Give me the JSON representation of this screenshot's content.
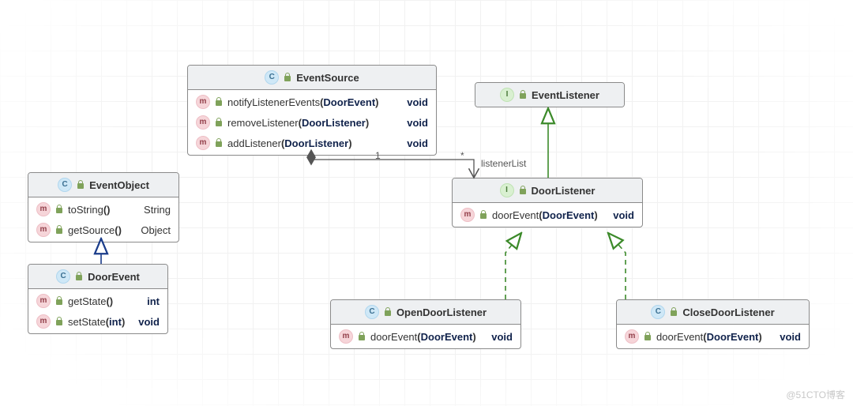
{
  "watermark": "@51CTO博客",
  "classes": {
    "EventSource": {
      "name": "EventSource",
      "stereotype": "C",
      "methods": [
        {
          "name": "notifyListenerEvents",
          "params": "DoorEvent",
          "ret": "void"
        },
        {
          "name": "removeListener",
          "params": "DoorListener",
          "ret": "void"
        },
        {
          "name": "addListener",
          "params": "DoorListener",
          "ret": "void"
        }
      ]
    },
    "EventListener": {
      "name": "EventListener",
      "stereotype": "I",
      "methods": []
    },
    "EventObject": {
      "name": "EventObject",
      "stereotype": "C",
      "methods": [
        {
          "name": "toString",
          "params": "",
          "ret": "String"
        },
        {
          "name": "getSource",
          "params": "",
          "ret": "Object"
        }
      ]
    },
    "DoorEvent": {
      "name": "DoorEvent",
      "stereotype": "C",
      "methods": [
        {
          "name": "getState",
          "params": "",
          "ret": "int"
        },
        {
          "name": "setState",
          "params": "int",
          "ret": "void"
        }
      ]
    },
    "DoorListener": {
      "name": "DoorListener",
      "stereotype": "I",
      "methods": [
        {
          "name": "doorEvent",
          "params": "DoorEvent",
          "ret": "void"
        }
      ]
    },
    "OpenDoorListener": {
      "name": "OpenDoorListener",
      "stereotype": "C",
      "methods": [
        {
          "name": "doorEvent",
          "params": "DoorEvent",
          "ret": "void"
        }
      ]
    },
    "CloseDoorListener": {
      "name": "CloseDoorListener",
      "stereotype": "C",
      "methods": [
        {
          "name": "doorEvent",
          "params": "DoorEvent",
          "ret": "void"
        }
      ]
    }
  },
  "relations": {
    "aggregation": {
      "mult_source": "1",
      "mult_target": "*",
      "role": "listenerList"
    }
  }
}
